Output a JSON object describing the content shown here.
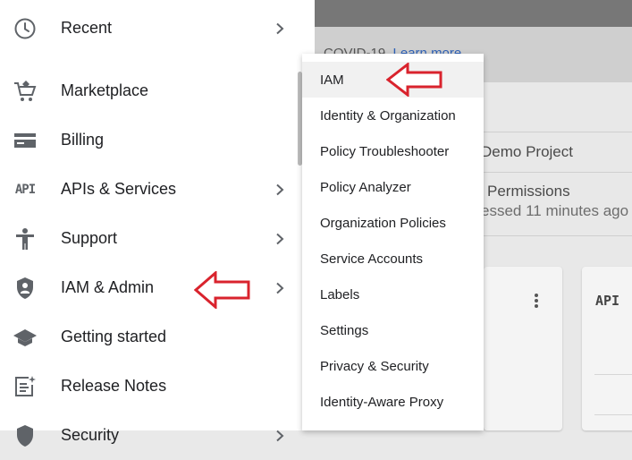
{
  "background": {
    "banner_text": "COVID-19.",
    "banner_link": "Learn more",
    "project_name": "Demo Project",
    "permissions_title": "Permissions",
    "permissions_subtitle": "essed 11 minutes ago",
    "card_api_label": "API"
  },
  "nav": {
    "items": [
      {
        "label": "Recent",
        "icon": "clock-icon",
        "has_submenu": true
      },
      {
        "label": "Marketplace",
        "icon": "cart-icon",
        "has_submenu": false
      },
      {
        "label": "Billing",
        "icon": "credit-card-icon",
        "has_submenu": false
      },
      {
        "label": "APIs & Services",
        "icon": "api-icon",
        "icon_text": "API",
        "has_submenu": true
      },
      {
        "label": "Support",
        "icon": "person-icon",
        "has_submenu": true
      },
      {
        "label": "IAM & Admin",
        "icon": "shield-icon",
        "has_submenu": true
      },
      {
        "label": "Getting started",
        "icon": "graduation-cap-icon",
        "has_submenu": false
      },
      {
        "label": "Release Notes",
        "icon": "notes-icon",
        "has_submenu": false
      },
      {
        "label": "Security",
        "icon": "shield-icon",
        "has_submenu": true
      }
    ]
  },
  "submenu": {
    "items": [
      {
        "label": "IAM",
        "active": true
      },
      {
        "label": "Identity & Organization"
      },
      {
        "label": "Policy Troubleshooter"
      },
      {
        "label": "Policy Analyzer"
      },
      {
        "label": "Organization Policies"
      },
      {
        "label": "Service Accounts"
      },
      {
        "label": "Labels"
      },
      {
        "label": "Settings"
      },
      {
        "label": "Privacy & Security"
      },
      {
        "label": "Identity-Aware Proxy"
      }
    ]
  },
  "colors": {
    "annotation_arrow": "#d9232d",
    "icon_gray": "#5f6368",
    "link_blue": "#2f62b7"
  }
}
